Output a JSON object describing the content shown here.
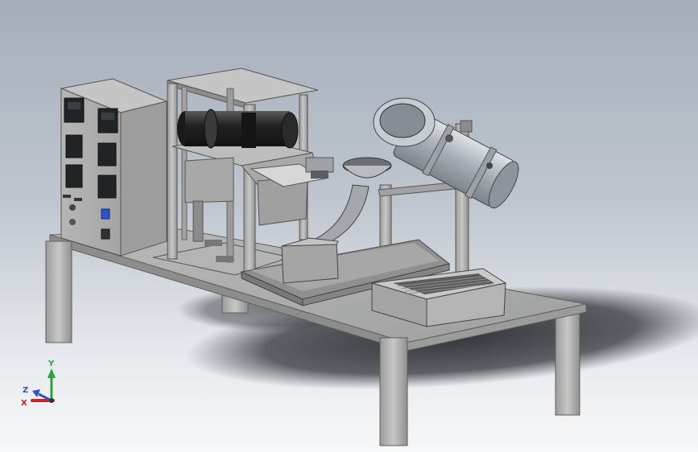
{
  "viewport": {
    "background_top": "#a4aeba",
    "background_bottom": "#f7f8f9",
    "model": {
      "frame_color": "#a9aaa9",
      "dark_part_color": "#2c2c2c",
      "steel_color": "#c3c7cc",
      "panel_display_color": "#202426",
      "button_color": "#2f52c4"
    }
  },
  "triad": {
    "y_label": "Y",
    "z_label": "Z",
    "x_label": "X",
    "y_color": "#2ea043",
    "z_color": "#2f52c4",
    "x_color": "#cc2222"
  }
}
